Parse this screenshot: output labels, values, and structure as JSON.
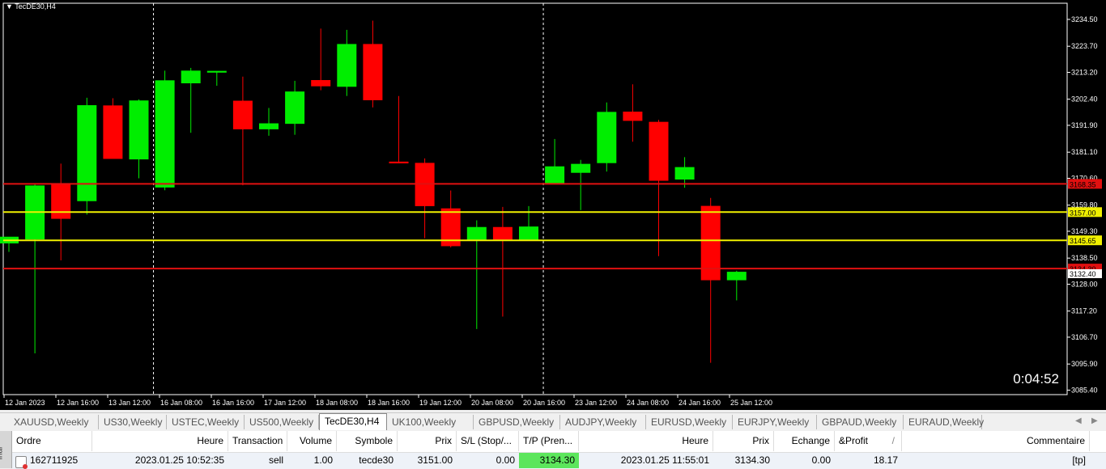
{
  "window": {
    "title": "TecDE30,H4",
    "countdown": "0:04:52"
  },
  "chart_data": {
    "type": "candlestick",
    "symbol": "TecDE30",
    "timeframe": "H4",
    "y_ticks": [
      3234.5,
      3223.7,
      3213.2,
      3202.4,
      3191.9,
      3181.1,
      3170.6,
      3159.8,
      3149.3,
      3138.5,
      3128.0,
      3117.2,
      3106.7,
      3095.9,
      3085.4
    ],
    "y_range": [
      3083.6,
      3241.0
    ],
    "x_labels": [
      "12 Jan 2023",
      "12 Jan 16:00",
      "13 Jan 12:00",
      "16 Jan 08:00",
      "16 Jan 16:00",
      "17 Jan 12:00",
      "18 Jan 08:00",
      "18 Jan 16:00",
      "19 Jan 12:00",
      "20 Jan 08:00",
      "20 Jan 16:00",
      "23 Jan 12:00",
      "24 Jan 08:00",
      "24 Jan 16:00",
      "25 Jan 12:00"
    ],
    "candles": [
      {
        "o": 3144.4,
        "h": 3146.3,
        "l": 3141.0,
        "c": 3147.1
      },
      {
        "o": 3146.0,
        "h": 3168.5,
        "l": 3100.2,
        "c": 3167.7
      },
      {
        "o": 3168.2,
        "h": 3176.5,
        "l": 3137.6,
        "c": 3154.3
      },
      {
        "o": 3161.4,
        "h": 3203.0,
        "l": 3156.0,
        "c": 3200.0
      },
      {
        "o": 3199.9,
        "h": 3202.8,
        "l": 3178.7,
        "c": 3178.4
      },
      {
        "o": 3178.2,
        "h": 3202.3,
        "l": 3170.6,
        "c": 3201.9
      },
      {
        "o": 3166.9,
        "h": 3213.9,
        "l": 3165.8,
        "c": 3210.0
      },
      {
        "o": 3208.8,
        "h": 3215.0,
        "l": 3188.9,
        "c": 3213.9
      },
      {
        "o": 3213.1,
        "h": 3213.5,
        "l": 3207.8,
        "c": 3213.8
      },
      {
        "o": 3201.8,
        "h": 3211.5,
        "l": 3167.8,
        "c": 3190.3
      },
      {
        "o": 3190.3,
        "h": 3198.9,
        "l": 3187.7,
        "c": 3192.7
      },
      {
        "o": 3192.5,
        "h": 3209.8,
        "l": 3188.1,
        "c": 3205.5
      },
      {
        "o": 3210.1,
        "h": 3230.8,
        "l": 3206.0,
        "c": 3207.6
      },
      {
        "o": 3207.4,
        "h": 3230.3,
        "l": 3203.7,
        "c": 3224.6
      },
      {
        "o": 3224.6,
        "h": 3234.0,
        "l": 3199.1,
        "c": 3202.0
      },
      {
        "o": 3177.3,
        "h": 3203.7,
        "l": 3177.0,
        "c": 3176.6
      },
      {
        "o": 3176.8,
        "h": 3178.6,
        "l": 3146.5,
        "c": 3159.4
      },
      {
        "o": 3158.5,
        "h": 3165.7,
        "l": 3142.8,
        "c": 3143.3
      },
      {
        "o": 3145.8,
        "h": 3153.7,
        "l": 3110.0,
        "c": 3151.0
      },
      {
        "o": 3151.0,
        "h": 3159.1,
        "l": 3115.0,
        "c": 3145.9
      },
      {
        "o": 3145.6,
        "h": 3159.4,
        "l": 3145.6,
        "c": 3151.2
      },
      {
        "o": 3168.3,
        "h": 3186.4,
        "l": 3168.2,
        "c": 3175.4
      },
      {
        "o": 3172.8,
        "h": 3178.0,
        "l": 3157.8,
        "c": 3176.4
      },
      {
        "o": 3176.7,
        "h": 3201.1,
        "l": 3173.3,
        "c": 3197.3
      },
      {
        "o": 3197.4,
        "h": 3208.4,
        "l": 3185.3,
        "c": 3193.7
      },
      {
        "o": 3193.3,
        "h": 3194.1,
        "l": 3139.3,
        "c": 3169.6
      },
      {
        "o": 3170.1,
        "h": 3179.1,
        "l": 3166.8,
        "c": 3175.1
      },
      {
        "o": 3159.5,
        "h": 3162.7,
        "l": 3096.4,
        "c": 3129.6
      },
      {
        "o": 3129.6,
        "h": 3133.4,
        "l": 3121.5,
        "c": 3133.0
      }
    ],
    "h_lines": [
      {
        "value": 3168.35,
        "label": "3168.35",
        "color": "#e01010"
      },
      {
        "value": 3157.0,
        "label": "3157.00",
        "color": "#f0f000"
      },
      {
        "value": 3145.65,
        "label": "3145.65",
        "color": "#f0f000"
      },
      {
        "value": 3134.3,
        "label": "3134.30",
        "color": "#e01010"
      }
    ],
    "bid_label": "3132.40",
    "v_lines_at_candle": [
      5.5,
      20.5
    ]
  },
  "tabs": [
    "XAUUSD,Weekly",
    "US30,Weekly",
    "USTEC,Weekly",
    "US500,Weekly",
    "TecDE30,H4",
    "UK100,Weekly",
    "GBPUSD,Weekly",
    "AUDJPY,Weekly",
    "EURUSD,Weekly",
    "EURJPY,Weekly",
    "GBPAUD,Weekly",
    "EURAUD,Weekly"
  ],
  "active_tab": "TecDE30,H4",
  "terminal": {
    "side_label": "inal",
    "headers": {
      "ordre": "Ordre",
      "heure": "Heure",
      "transaction": "Transaction",
      "volume": "Volume",
      "symbole": "Symbole",
      "prix": "Prix",
      "sl": "S/L (Stop/...",
      "tp": "T/P (Pren...",
      "heure2": "Heure",
      "prix2": "Prix",
      "echange": "Echange",
      "profit": "&Profit",
      "commentaire": "Commentaire"
    },
    "row": {
      "ordre": "162711925",
      "heure": "2023.01.25 10:52:35",
      "transaction": "sell",
      "volume": "1.00",
      "symbole": "tecde30",
      "prix": "3151.00",
      "sl": "0.00",
      "tp": "3134.30",
      "heure2": "2023.01.25 11:55:01",
      "prix2": "3134.30",
      "echange": "0.00",
      "profit": "18.17",
      "commentaire": "[tp]"
    },
    "sort_indicator": "/"
  },
  "colors": {
    "bull": "#00ee00",
    "bear": "#ff0000",
    "background": "#000000",
    "tp_highlight": "#5ce65c"
  }
}
